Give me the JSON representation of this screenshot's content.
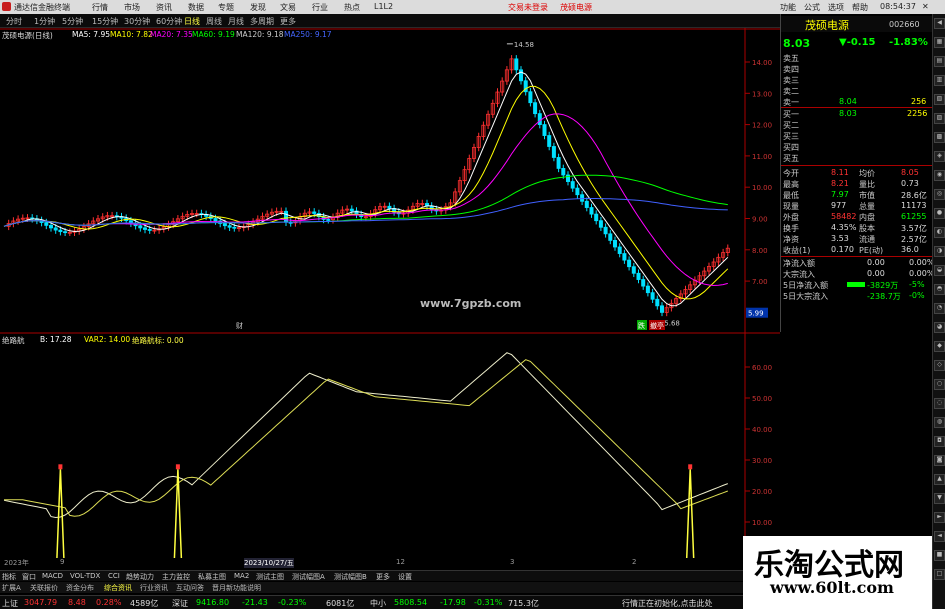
{
  "titlebar": {
    "app_name": "通达信金融终端",
    "menus": [
      "行情",
      "市场",
      "资讯",
      "数据",
      "专题",
      "发现",
      "文易",
      "行业",
      "热点",
      "L1L2"
    ],
    "login_text": "交易未登录",
    "stock_title": "茂硕电源",
    "right_menus": [
      "功能",
      "公式",
      "选项",
      "帮助"
    ],
    "clock": "08:54:37"
  },
  "periods": [
    "分时",
    "1分钟",
    "5分钟",
    "15分钟",
    "30分钟",
    "60分钟",
    "日线",
    "周线",
    "月线",
    "多周期",
    "更多"
  ],
  "active_period": "日线",
  "legend_main": {
    "name": "茂硕电源(日线)",
    "ma5": "MA5: 7.95",
    "ma10": "MA10: 7.82",
    "ma20": "MA20: 7.35",
    "ma60": "MA60: 9.19",
    "ma120": "MA120: 9.18",
    "ma250": "MA250: 9.17"
  },
  "legend_sub": {
    "name": "绝路航",
    "b": "B: 17.28",
    "var2": "VAR2: 14.00",
    "signal": "绝路航标: 0.00"
  },
  "price_axis": [
    "14.00",
    "13.00",
    "12.00",
    "11.00",
    "10.00",
    "9.00",
    "8.00",
    "7.00"
  ],
  "sub_axis": [
    "60.00",
    "50.00",
    "40.00",
    "30.00",
    "20.00",
    "10.00"
  ],
  "annotations": {
    "high": "14.58",
    "low": "5.68",
    "current_tag": "5.99",
    "site": "www.7gpzb.com",
    "marker1": "财",
    "marker2": "跌",
    "marker3": "撤亭"
  },
  "quote": {
    "name": "茂硕电源",
    "code": "002660",
    "price": "8.03",
    "change": "▼-0.15",
    "pct": "-1.83%",
    "sell_labels": [
      "卖五",
      "卖四",
      "卖三",
      "卖二",
      "卖一"
    ],
    "sell1_price": "8.04",
    "sell1_vol": "256",
    "buy_labels": [
      "买一",
      "买二",
      "买三",
      "买四",
      "买五"
    ],
    "buy1_price": "8.03",
    "buy1_vol": "2256",
    "stats": [
      [
        "今开",
        "8.11",
        "均价",
        "8.05"
      ],
      [
        "最高",
        "8.21",
        "量比",
        "0.73"
      ],
      [
        "最低",
        "7.97",
        "市值",
        "28.6亿"
      ],
      [
        "现量",
        "977",
        "总量",
        "11173"
      ],
      [
        "外盘",
        "58482",
        "内盘",
        "61255"
      ],
      [
        "换手",
        "4.35%",
        "股本",
        "3.57亿"
      ],
      [
        "净资",
        "3.53",
        "流通",
        "2.57亿"
      ],
      [
        "收益(1)",
        "0.170",
        "PE(动)",
        "36.0"
      ]
    ],
    "flows": [
      [
        "净流入额",
        "0.00",
        "0.00%"
      ],
      [
        "大宗流入",
        "0.00",
        "0.00%"
      ],
      [
        "5日净流入额",
        "-3829万",
        "-5%"
      ],
      [
        "5日大宗流入",
        "-238.7万",
        "-0%"
      ]
    ]
  },
  "dates": [
    "2023年",
    "9",
    "2023/10/27/五",
    "12",
    "3",
    "2"
  ],
  "tabs": [
    "指标",
    "窗口",
    "MACD",
    "VOL-TDX",
    "CCI",
    "趋势动力",
    "主力监控",
    "私募主图",
    "MA2",
    "测试主图",
    "测试幅图A",
    "测试幅图B",
    "更多",
    "设置"
  ],
  "tabs2": [
    "扩展A",
    "关联报价",
    "资金分布",
    "综合资讯",
    "行业资讯",
    "互动问答",
    "晋月新功能说明"
  ],
  "status": {
    "sh_label": "上证",
    "sh_val": "3047.79",
    "sh_chg": "8.48",
    "sh_pct": "0.28%",
    "sh_amt": "4589亿",
    "sz_label": "深证",
    "sz_val": "9416.80",
    "sz_chg": "-21.43",
    "sz_pct": "-0.23%",
    "sz_amt": "6081亿",
    "zx_label": "中小",
    "zx_val": "5808.54",
    "zx_chg": "-17.98",
    "zx_pct": "-0.31%",
    "zx_amt": "715.3亿",
    "msg": "行情正在初始化,点击此处"
  },
  "watermark": {
    "line1": "乐淘公式网",
    "line2": "www.60lt.com"
  },
  "colors": {
    "up": "#ff3030",
    "down": "#00e0ff",
    "ma5": "#ffffff",
    "ma10": "#ffff00",
    "ma20": "#ff00ff",
    "ma60": "#00ff00",
    "ma120": "#4060ff",
    "signal": "#ffff40"
  }
}
